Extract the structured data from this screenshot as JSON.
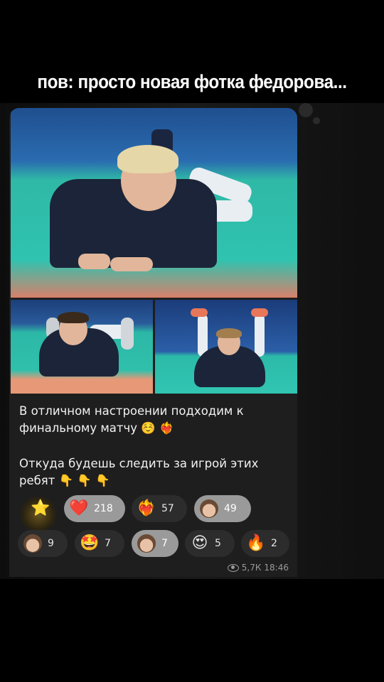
{
  "caption": "пов: просто новая фотка федорова...",
  "post": {
    "text_line1": "В отличном настроении подходим к финальному матчу ☺️ ❤️‍🔥",
    "text_line2": "Откуда будешь следить за игрой этих ребят 👇 👇 👇",
    "views": "5,7К",
    "time": "18:46"
  },
  "reactions": [
    {
      "icon": "star",
      "glyph": "⭐",
      "count": ""
    },
    {
      "icon": "heart",
      "glyph": "❤️",
      "count": "218",
      "active": true
    },
    {
      "icon": "heart-on-fire",
      "glyph": "❤️‍🔥",
      "count": "57"
    },
    {
      "icon": "avatar-player-1",
      "glyph": "",
      "count": "49",
      "active": true
    },
    {
      "icon": "avatar-player-2",
      "glyph": "",
      "count": "9"
    },
    {
      "icon": "star-struck",
      "glyph": "🤩",
      "count": "7"
    },
    {
      "icon": "avatar-player-3",
      "glyph": "",
      "count": "7",
      "active": true
    },
    {
      "icon": "heart-eyes",
      "glyph": "😍",
      "count": "5"
    },
    {
      "icon": "fire",
      "glyph": "🔥",
      "count": "2"
    }
  ]
}
